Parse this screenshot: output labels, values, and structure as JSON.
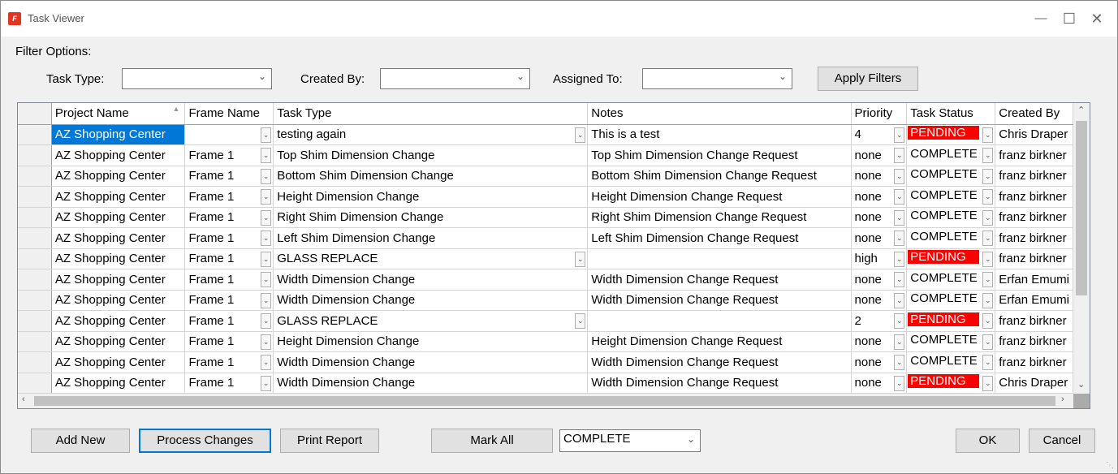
{
  "window": {
    "title": "Task Viewer",
    "icon": "app-logo-icon"
  },
  "filters": {
    "heading": "Filter Options:",
    "task_type_label": "Task Type:",
    "task_type_value": "",
    "created_by_label": "Created By:",
    "created_by_value": "",
    "assigned_to_label": "Assigned To:",
    "assigned_to_value": "",
    "apply_label": "Apply Filters"
  },
  "grid": {
    "columns": [
      "Project Name",
      "Frame Name",
      "Task Type",
      "Notes",
      "Priority",
      "Task Status",
      "Created By"
    ],
    "rows": [
      {
        "project": "AZ Shopping Center",
        "frame": "",
        "task_type": "testing again",
        "notes": "This is a test",
        "priority": "4",
        "status": "PENDING",
        "created_by": "Chris Draper"
      },
      {
        "project": "AZ Shopping Center",
        "frame": "Frame 1",
        "task_type": "Top Shim Dimension Change",
        "notes": "Top Shim Dimension Change Request",
        "priority": "none",
        "status": "COMPLETE",
        "created_by": "franz birkner"
      },
      {
        "project": "AZ Shopping Center",
        "frame": "Frame 1",
        "task_type": "Bottom Shim Dimension Change",
        "notes": "Bottom Shim Dimension Change Request",
        "priority": "none",
        "status": "COMPLETE",
        "created_by": "franz birkner"
      },
      {
        "project": "AZ Shopping Center",
        "frame": "Frame 1",
        "task_type": "Height Dimension Change",
        "notes": "Height Dimension Change Request",
        "priority": "none",
        "status": "COMPLETE",
        "created_by": "franz birkner"
      },
      {
        "project": "AZ Shopping Center",
        "frame": "Frame 1",
        "task_type": "Right Shim Dimension Change",
        "notes": "Right Shim Dimension Change Request",
        "priority": "none",
        "status": "COMPLETE",
        "created_by": "franz birkner"
      },
      {
        "project": "AZ Shopping Center",
        "frame": "Frame 1",
        "task_type": "Left Shim Dimension Change",
        "notes": "Left Shim Dimension Change Request",
        "priority": "none",
        "status": "COMPLETE",
        "created_by": "franz birkner"
      },
      {
        "project": "AZ Shopping Center",
        "frame": "Frame 1",
        "task_type": "GLASS REPLACE",
        "notes": "",
        "priority": "high",
        "status": "PENDING",
        "created_by": "franz birkner"
      },
      {
        "project": "AZ Shopping Center",
        "frame": "Frame 1",
        "task_type": "Width Dimension Change",
        "notes": "Width Dimension Change Request",
        "priority": "none",
        "status": "COMPLETE",
        "created_by": "Erfan Emumi"
      },
      {
        "project": "AZ Shopping Center",
        "frame": "Frame 1",
        "task_type": "Width Dimension Change",
        "notes": "Width Dimension Change Request",
        "priority": "none",
        "status": "COMPLETE",
        "created_by": "Erfan Emumi"
      },
      {
        "project": "AZ Shopping Center",
        "frame": "Frame 1",
        "task_type": "GLASS REPLACE",
        "notes": "",
        "priority": "2",
        "status": "PENDING",
        "created_by": "franz birkner"
      },
      {
        "project": "AZ Shopping Center",
        "frame": "Frame 1",
        "task_type": "Height Dimension Change",
        "notes": "Height Dimension Change Request",
        "priority": "none",
        "status": "COMPLETE",
        "created_by": "franz birkner"
      },
      {
        "project": "AZ Shopping Center",
        "frame": "Frame 1",
        "task_type": "Width Dimension Change",
        "notes": "Width Dimension Change Request",
        "priority": "none",
        "status": "COMPLETE",
        "created_by": "franz birkner"
      },
      {
        "project": "AZ Shopping Center",
        "frame": "Frame 1",
        "task_type": "Width Dimension Change",
        "notes": "Width Dimension Change Request",
        "priority": "none",
        "status": "PENDING",
        "created_by": "Chris Draper"
      }
    ]
  },
  "footer": {
    "add_new_label": "Add New",
    "process_changes_label": "Process Changes",
    "print_report_label": "Print Report",
    "mark_all_label": "Mark All",
    "mark_all_value": "COMPLETE",
    "ok_label": "OK",
    "cancel_label": "Cancel"
  },
  "colors": {
    "selection": "#0078d7",
    "pending": "#ff0000"
  }
}
